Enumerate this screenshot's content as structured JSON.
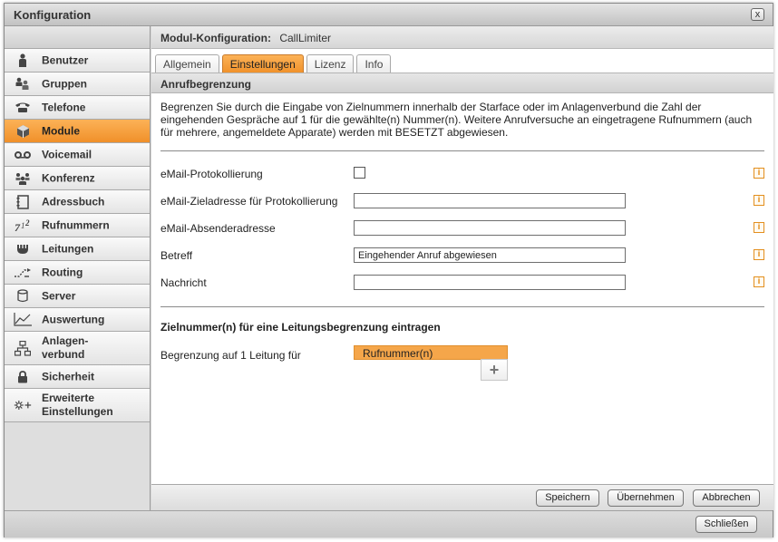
{
  "window": {
    "title": "Konfiguration",
    "close_label": "x"
  },
  "sidebar": {
    "items": [
      {
        "label": "Benutzer",
        "icon": "user-icon"
      },
      {
        "label": "Gruppen",
        "icon": "group-icon"
      },
      {
        "label": "Telefone",
        "icon": "phone-icon"
      },
      {
        "label": "Module",
        "icon": "cube-icon",
        "active": true
      },
      {
        "label": "Voicemail",
        "icon": "voicemail-icon"
      },
      {
        "label": "Konferenz",
        "icon": "conference-icon"
      },
      {
        "label": "Adressbuch",
        "icon": "addressbook-icon"
      },
      {
        "label": "Rufnummern",
        "icon": "numbers-icon"
      },
      {
        "label": "Leitungen",
        "icon": "lines-icon"
      },
      {
        "label": "Routing",
        "icon": "routing-icon"
      },
      {
        "label": "Server",
        "icon": "server-icon"
      },
      {
        "label": "Auswertung",
        "icon": "chart-icon"
      },
      {
        "label": "Anlagen-\nverbund",
        "icon": "network-icon"
      },
      {
        "label": "Sicherheit",
        "icon": "lock-icon"
      },
      {
        "label": "Erweiterte\nEinstellungen",
        "icon": "settings-plus-icon"
      }
    ]
  },
  "module": {
    "header_label": "Modul-Konfiguration:",
    "header_value": "CallLimiter"
  },
  "tabs": [
    {
      "label": "Allgemein"
    },
    {
      "label": "Einstellungen",
      "active": true
    },
    {
      "label": "Lizenz"
    },
    {
      "label": "Info"
    }
  ],
  "section": {
    "title": "Anrufbegrenzung",
    "description": "Begrenzen Sie durch die Eingabe von Zielnummern innerhalb der Starface oder im Anlagenverbund die Zahl der eingehenden Gespräche auf 1 für die gewählte(n) Nummer(n). Weitere Anrufversuche an eingetragene Rufnummern (auch für mehrere, angemeldete Apparate) werden mit BESETZT abgewiesen."
  },
  "form": {
    "email_logging": {
      "label": "eMail-Protokollierung",
      "checked": false
    },
    "email_target": {
      "label": "eMail-Zieladresse für Protokollierung",
      "value": ""
    },
    "email_sender": {
      "label": "eMail-Absenderadresse",
      "value": ""
    },
    "subject": {
      "label": "Betreff",
      "value": "Eingehender Anruf abgewiesen"
    },
    "message": {
      "label": "Nachricht",
      "value": ""
    },
    "info_glyph": "i"
  },
  "limit": {
    "heading": "Zielnummer(n) für eine Leitungsbegrenzung eintragen",
    "label": "Begrenzung auf 1 Leitung für",
    "column_header": "Rufnummer(n)",
    "add_glyph": "+"
  },
  "buttons": {
    "save": "Speichern",
    "apply": "Übernehmen",
    "cancel": "Abbrechen",
    "close": "Schließen"
  },
  "colors": {
    "accent": "#f39c35",
    "info": "#e38f1e"
  }
}
